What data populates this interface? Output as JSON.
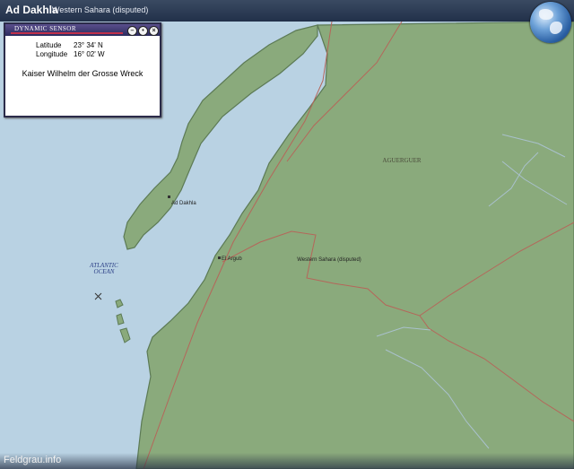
{
  "header": {
    "place": "Ad Dakhla",
    "region": "Western Sahara (disputed)"
  },
  "sensor": {
    "title": "DYNAMIC SENSOR",
    "latitude_label": "Latitude",
    "latitude_value": "23° 34' N",
    "longitude_label": "Longitude",
    "longitude_value": "16° 02' W",
    "location_name": "Kaiser Wilhelm der Grosse Wreck"
  },
  "map_labels": {
    "ocean_line1": "ATLANTIC",
    "ocean_line2": "OCEAN",
    "city": "Ad Dakhla",
    "town": "El Argub",
    "region_label": "Western Sahara (disputed)",
    "area": "AGUERGUER"
  },
  "footer": {
    "brand": "Feldgrau.info"
  },
  "colors": {
    "water": "#b9d2e3",
    "land": "#8aaa7c",
    "coast": "#5c7a55",
    "border": "#b5665a",
    "marker": "#333333"
  }
}
